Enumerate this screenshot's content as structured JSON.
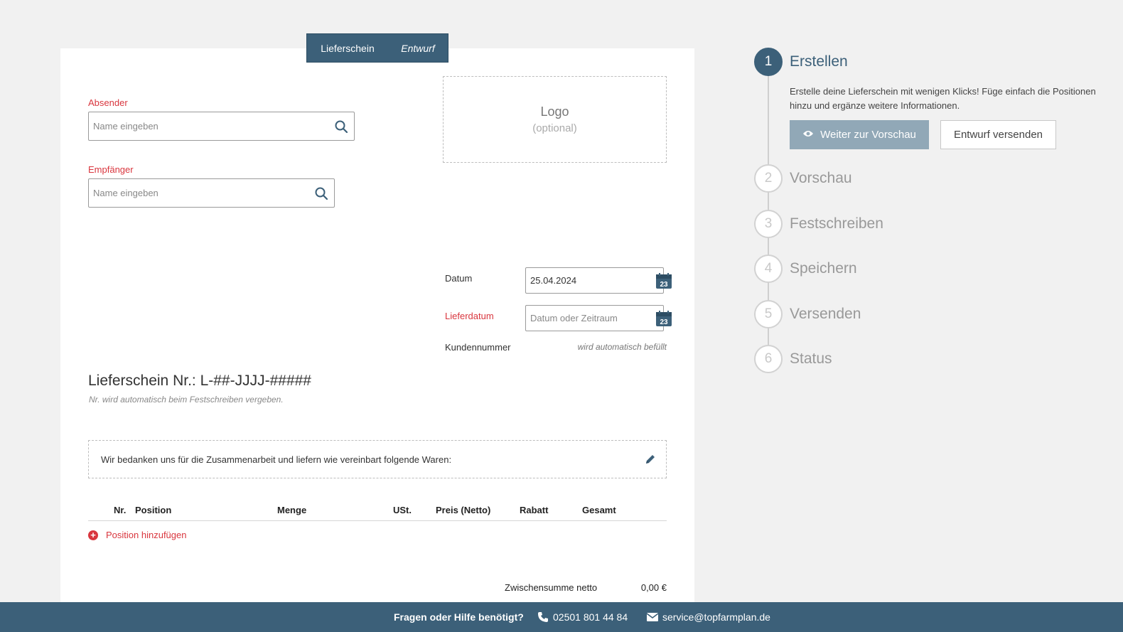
{
  "document": {
    "tab_type": "Lieferschein",
    "tab_status": "Entwurf",
    "sender": {
      "label": "Absender",
      "placeholder": "Name eingeben"
    },
    "recipient": {
      "label": "Empfänger",
      "placeholder": "Name eingeben"
    },
    "logo": {
      "title": "Logo",
      "subtitle": "(optional)"
    },
    "date": {
      "label": "Datum",
      "value": "25.04.2024",
      "calendar_day": "23"
    },
    "delivery_date": {
      "label": "Lieferdatum",
      "placeholder": "Datum oder Zeitraum",
      "calendar_day": "23"
    },
    "customer_number": {
      "label": "Kundennummer",
      "value": "wird automatisch befüllt"
    },
    "title": "Lieferschein Nr.: L-##-JJJJ-#####",
    "number_note": "Nr. wird automatisch beim Festschreiben vergeben.",
    "intro_text": "Wir bedanken uns für die Zusammenarbeit und liefern wie vereinbart folgende Waren:",
    "table": {
      "columns": [
        "Nr.",
        "Position",
        "Menge",
        "USt.",
        "Preis (Netto)",
        "Rabatt",
        "Gesamt"
      ]
    },
    "add_position": "Position hinzufügen",
    "subtotal_label": "Zwischensumme netto",
    "subtotal_value": "0,00 €"
  },
  "stepper": {
    "steps": [
      {
        "number": "1",
        "name": "Erstellen"
      },
      {
        "number": "2",
        "name": "Vorschau"
      },
      {
        "number": "3",
        "name": "Festschreiben"
      },
      {
        "number": "4",
        "name": "Speichern"
      },
      {
        "number": "5",
        "name": "Versenden"
      },
      {
        "number": "6",
        "name": "Status"
      }
    ],
    "active_step": "1",
    "description": "Erstelle deine Lieferschein mit wenigen Klicks! Füge einfach die Positionen hinzu und ergänze weitere Informationen.",
    "preview_button": "Weiter zur Vorschau",
    "send_draft_button": "Entwurf versenden"
  },
  "footer": {
    "question": "Fragen oder Hilfe benötigt?",
    "phone": "02501 801 44 84",
    "email": "service@topfarmplan.de"
  },
  "colors": {
    "primary": "#3c6079",
    "accent_red": "#d9363e",
    "disabled_button": "#91a8b7"
  },
  "icons": [
    "search-icon",
    "calendar-icon",
    "pencil-icon",
    "plus-circle-icon",
    "eye-icon",
    "phone-icon",
    "envelope-icon"
  ]
}
